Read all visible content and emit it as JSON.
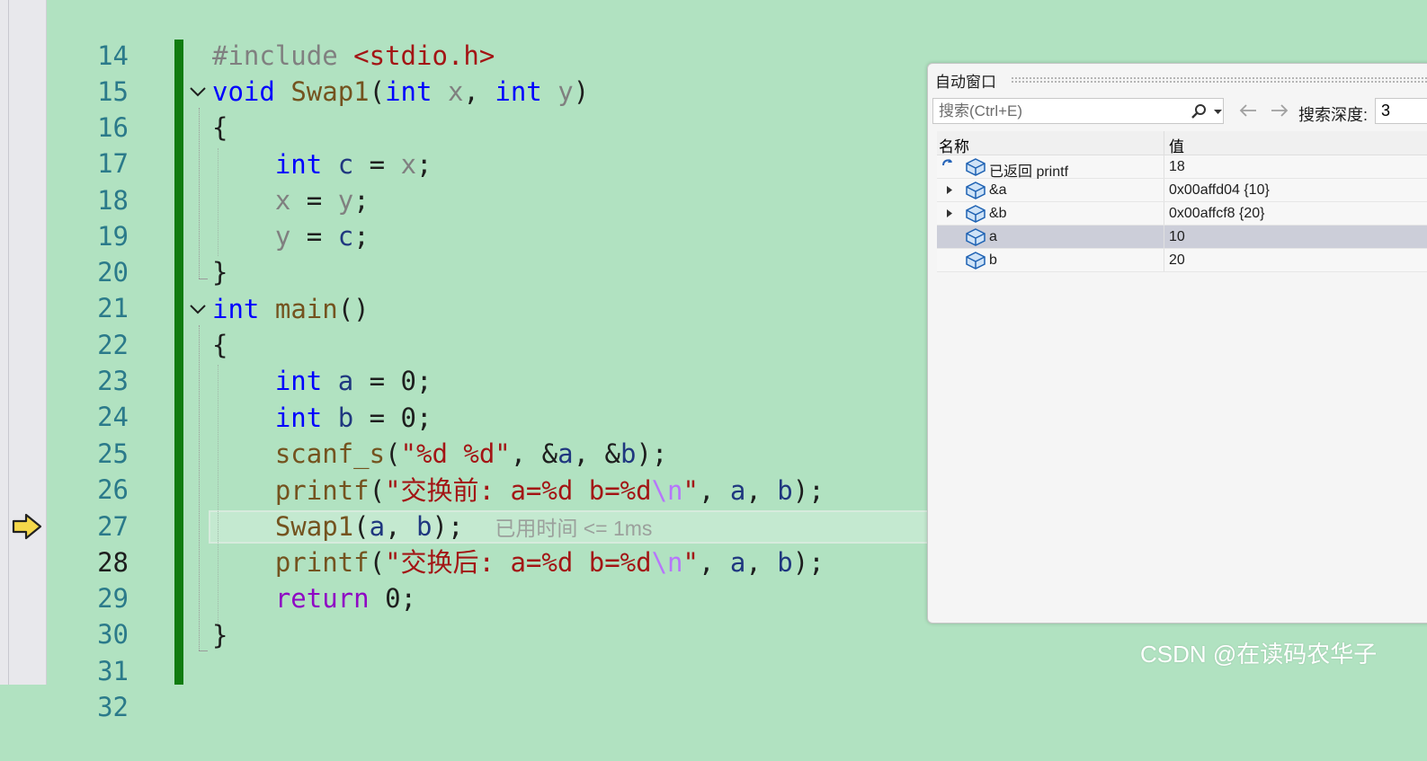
{
  "editor": {
    "line_numbers": [
      "14",
      "15",
      "16",
      "17",
      "18",
      "19",
      "20",
      "21",
      "22",
      "23",
      "24",
      "25",
      "26",
      "27",
      "28",
      "29",
      "30",
      "31",
      "32"
    ],
    "code": {
      "l15_pre": "#include",
      "l15_inc": "<stdio.h>",
      "l16_kw": "void",
      "l16_fn": "Swap1",
      "l16_open": "(",
      "l16_int1": "int",
      "l16_p1": "x",
      "l16_comma": ",",
      "l16_int2": "int",
      "l16_p2": "y",
      "l16_close": ")",
      "l17": "{",
      "l18_kw": "int",
      "l18_var": "c",
      "l18_eq": "=",
      "l18_par": "x",
      "l18_semi": ";",
      "l19_par": "x",
      "l19_eq": "=",
      "l19_par2": "y",
      "l19_semi": ";",
      "l20_par": "y",
      "l20_eq": "=",
      "l20_var": "c",
      "l20_semi": ";",
      "l21": "}",
      "l22_kw": "int",
      "l22_fn": "main",
      "l22_paren": "()",
      "l23": "{",
      "l24_kw": "int",
      "l24_var": "a",
      "l24_rest": "= 0;",
      "l25_kw": "int",
      "l25_var": "b",
      "l25_rest": "= 0;",
      "l26_fn": "scanf_s",
      "l26_open": "(",
      "l26_str": "\"%d %d\"",
      "l26_mid": ", &",
      "l26_a": "a",
      "l26_mid2": ", &",
      "l26_b": "b",
      "l26_end": ");",
      "l27_fn": "printf",
      "l27_open": "(",
      "l27_str": "\"交换前: a=%d b=%d",
      "l27_esc": "\\n",
      "l27_q": "\"",
      "l27_c1": ", ",
      "l27_a": "a",
      "l27_c2": ", ",
      "l27_b": "b",
      "l27_end": ");",
      "l28_fn": "Swap1",
      "l28_open": "(",
      "l28_a": "a",
      "l28_c": ", ",
      "l28_b": "b",
      "l28_end": ");",
      "l28_perf": "已用时间 <= 1ms",
      "l29_fn": "printf",
      "l29_open": "(",
      "l29_str": "\"交换后: a=%d b=%d",
      "l29_esc": "\\n",
      "l29_q": "\"",
      "l29_c1": ", ",
      "l29_a": "a",
      "l29_c2": ", ",
      "l29_b": "b",
      "l29_end": ");",
      "l30_kw": "return",
      "l30_rest": " 0;",
      "l31": "}"
    },
    "current_line": "28"
  },
  "autos": {
    "title": "自动窗口",
    "search_placeholder": "搜索(Ctrl+E)",
    "depth_label": "搜索深度:",
    "depth_value": "3",
    "col_name": "名称",
    "col_value": "值",
    "rows": [
      {
        "name": "已返回 printf",
        "value": "18"
      },
      {
        "name": "&a",
        "value": "0x00affd04 {10}"
      },
      {
        "name": "&b",
        "value": "0x00affcf8 {20}"
      },
      {
        "name": "a",
        "value": "10"
      },
      {
        "name": "b",
        "value": "20"
      }
    ]
  },
  "watermark": "CSDN @在读码农华子"
}
